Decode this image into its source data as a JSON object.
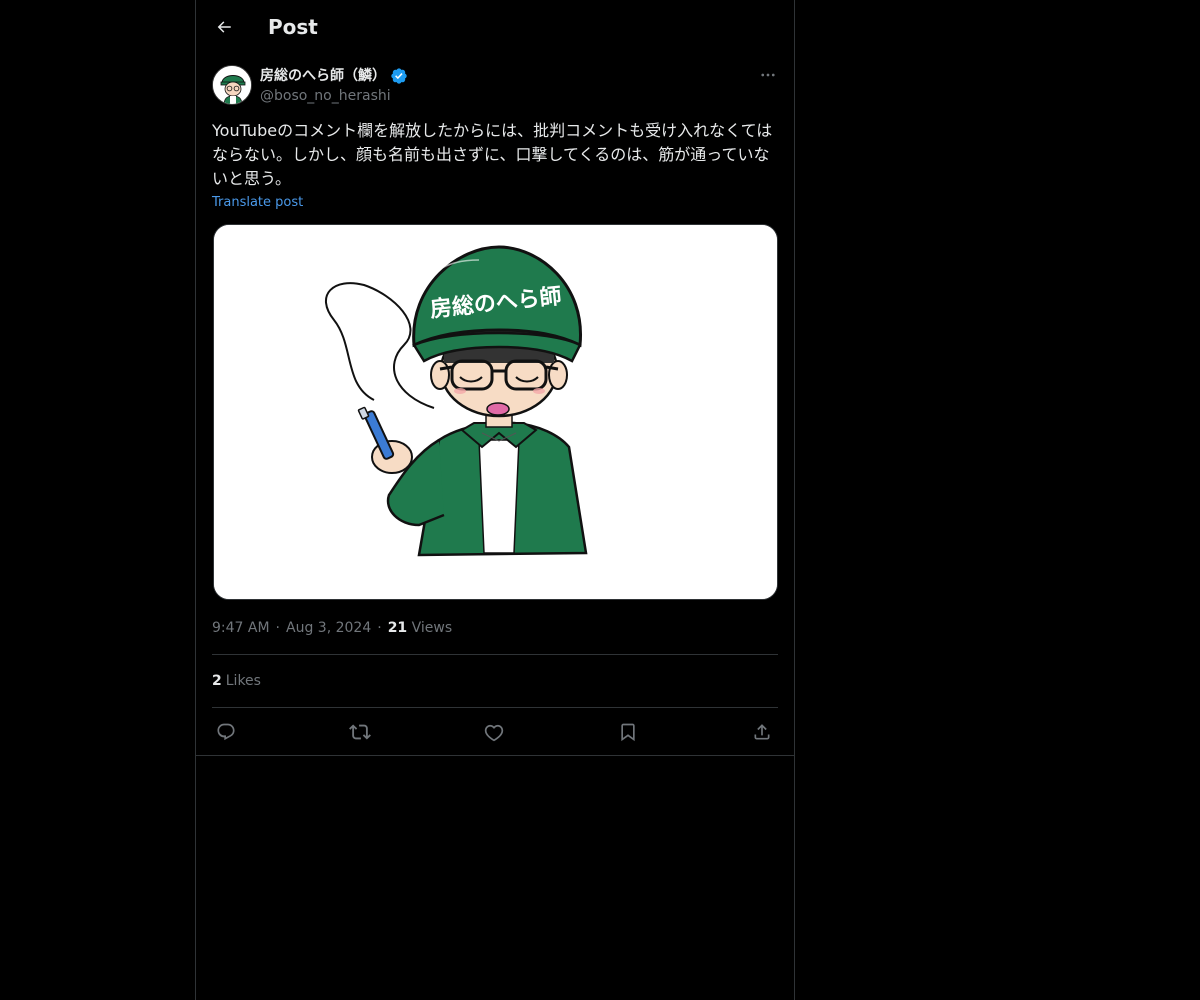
{
  "header": {
    "title": "Post"
  },
  "author": {
    "display_name": "房総のへら師（鱗）",
    "handle": "@boso_no_herashi",
    "verified": true
  },
  "post": {
    "text": "YouTubeのコメント欄を解放したからには、批判コメントも受け入れなくてはならない。しかし、顔も名前も出さずに、口撃してくるのは、筋が通っていないと思う。",
    "translate_label": "Translate post",
    "media_text": "房総のへら師",
    "time": "9:47 AM",
    "date": "Aug 3, 2024",
    "views_count": "21",
    "views_label": "Views",
    "likes_count": "2",
    "likes_label": "Likes"
  },
  "colors": {
    "background": "#000000",
    "text": "#e7e9ea",
    "muted": "#71767b",
    "border": "#2f3336",
    "link": "#4a99e9",
    "verified": "#1d9bf0",
    "cap_green": "#1f7a4d"
  },
  "icons": {
    "back": "arrow-left-icon",
    "verified": "verified-badge-icon",
    "more": "more-horizontal-icon",
    "reply": "reply-icon",
    "repost": "repost-icon",
    "like": "heart-icon",
    "bookmark": "bookmark-icon",
    "share": "share-icon"
  }
}
